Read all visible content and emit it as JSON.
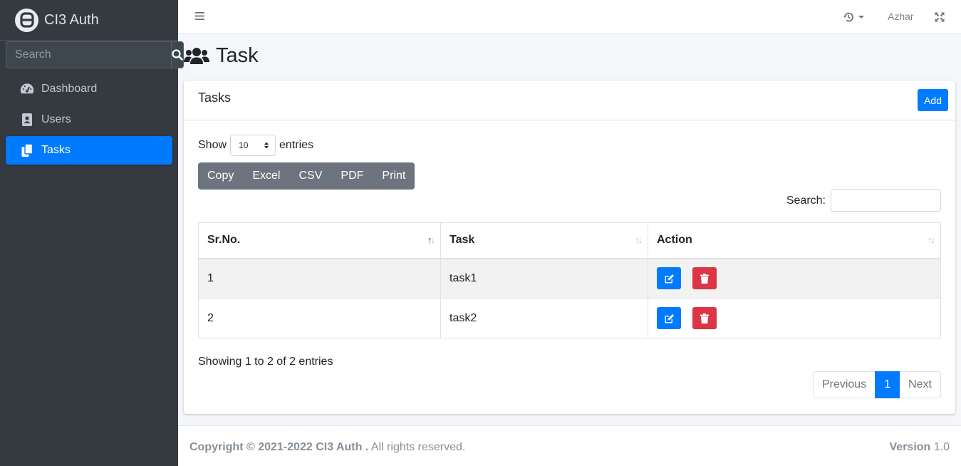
{
  "brand": {
    "name": "CI3 Auth"
  },
  "sidebar": {
    "search_placeholder": "Search",
    "items": [
      {
        "label": "Dashboard",
        "icon": "tachometer-icon",
        "active": false
      },
      {
        "label": "Users",
        "icon": "address-book-icon",
        "active": false
      },
      {
        "label": "Tasks",
        "icon": "copy-icon",
        "active": true
      }
    ]
  },
  "topnav": {
    "user": "Azhar"
  },
  "page": {
    "title": "Task"
  },
  "card": {
    "title": "Tasks",
    "add_label": "Add",
    "show_label": "Show",
    "entries_label": "entries",
    "page_length": "10",
    "export_buttons": [
      "Copy",
      "Excel",
      "CSV",
      "PDF",
      "Print"
    ],
    "search_label": "Search:",
    "search_value": ""
  },
  "table": {
    "columns": [
      "Sr.No.",
      "Task",
      "Action"
    ],
    "rows": [
      {
        "sr": "1",
        "task": "task1"
      },
      {
        "sr": "2",
        "task": "task2"
      }
    ]
  },
  "info": "Showing 1 to 2 of 2 entries",
  "pagination": {
    "previous": "Previous",
    "current": "1",
    "next": "Next"
  },
  "footer": {
    "copyright_bold": "Copyright © 2021-2022 CI3 Auth .",
    "copyright_rest": " All rights reserved.",
    "version_label": "Version",
    "version_value": " 1.0"
  },
  "colors": {
    "primary": "#007bff",
    "danger": "#dc3545",
    "sidebar": "#343a40",
    "secondary": "#6c757d"
  }
}
